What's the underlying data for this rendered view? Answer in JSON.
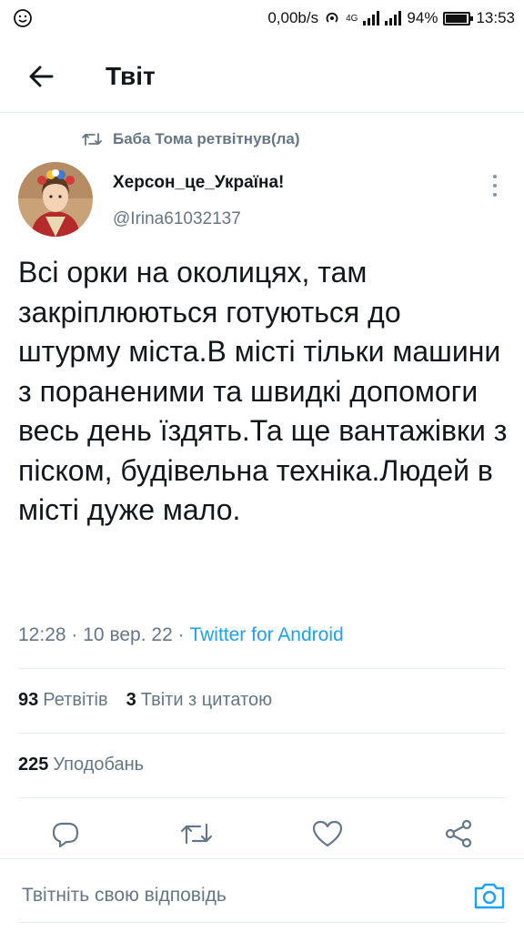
{
  "status_bar": {
    "network_speed": "0,00b/s",
    "network_type": "4G",
    "battery": "94%",
    "battery_level": 0.94,
    "time": "13:53"
  },
  "header": {
    "title": "Твіт",
    "back_icon": "arrow-left-icon"
  },
  "tweet": {
    "retweeted_by": "Баба Тома ретвітнув(ла)",
    "author_name": "Херсон_це_Україна!",
    "author_handle": "@Irina61032137",
    "text": "Всі орки на околицях, там закріплюються готуються до штурму міста.В місті тільки машини з пораненими та швидкі допомоги весь день їздять.Та ще вантажівки з піском, будівельна техніка.Людей в місті дуже мало.",
    "time": "12:28",
    "date": "10 вер. 22",
    "source": "Twitter for Android",
    "separator": "·"
  },
  "stats": {
    "retweets_count": "93",
    "retweets_label": "Ретвітів",
    "quotes_count": "3",
    "quotes_label": "Твіти з цитатою",
    "likes_count": "225",
    "likes_label": "Уподобань"
  },
  "actions": [
    "reply-icon",
    "retweet-icon",
    "like-icon",
    "share-icon"
  ],
  "reply": {
    "placeholder": "Твітніть свою відповідь"
  },
  "colors": {
    "accent": "#1da1f2",
    "secondary_text": "#657786",
    "divider": "#e6ecf0"
  }
}
